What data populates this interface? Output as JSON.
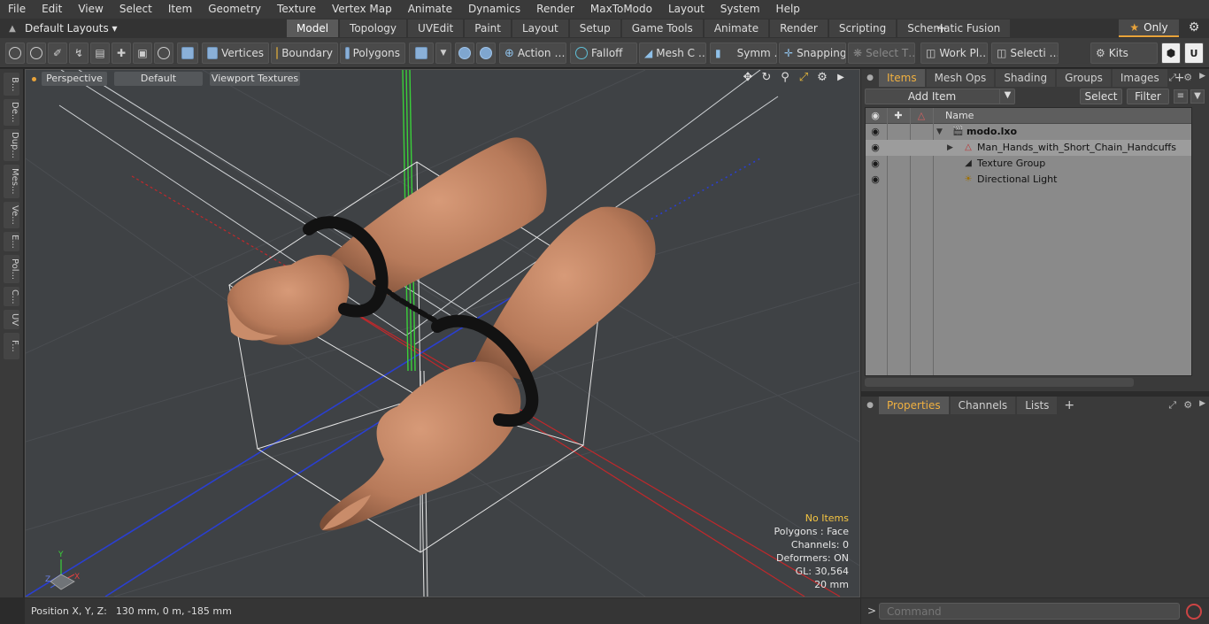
{
  "menu": [
    "File",
    "Edit",
    "View",
    "Select",
    "Item",
    "Geometry",
    "Texture",
    "Vertex Map",
    "Animate",
    "Dynamics",
    "Render",
    "MaxToModo",
    "Layout",
    "System",
    "Help"
  ],
  "layouts": {
    "label": "Default Layouts ▾"
  },
  "tabs": [
    "Model",
    "Topology",
    "UVEdit",
    "Paint",
    "Layout",
    "Setup",
    "Game Tools",
    "Animate",
    "Render",
    "Scripting",
    "Schematic Fusion"
  ],
  "only_label": "Only",
  "toolbar": {
    "vertices": "Vertices",
    "boundary": "Boundary",
    "polygons": "Polygons",
    "action": "Action",
    "falloff": "Falloff",
    "mesh": "Mesh C …",
    "symm": "Symm …",
    "snapping": "Snapping",
    "select_t": "Select T…",
    "workpl": "Work Pl…",
    "selecti": "Selecti …",
    "kits": "Kits"
  },
  "left_strip": [
    "B...",
    "De...",
    "Dup...",
    "Mes...",
    "Ve...",
    "E...",
    "Pol...",
    "C...",
    "UV",
    "F..."
  ],
  "viewport": {
    "view": "Perspective",
    "shading": "Default",
    "textures": "Viewport Textures",
    "stats": [
      "No Items",
      "Polygons : Face",
      "Channels: 0",
      "Deformers: ON",
      "GL: 30,564",
      "20 mm"
    ]
  },
  "status": {
    "label": "Position X, Y, Z:",
    "value": "130 mm, 0 m, -185 mm"
  },
  "items_panel": {
    "tabs": [
      "Items",
      "Mesh Ops",
      "Shading",
      "Groups",
      "Images"
    ],
    "add_item": "Add Item",
    "select": "Select",
    "filter": "Filter",
    "column": "Name",
    "rows": [
      "modo.lxo",
      "Man_Hands_with_Short_Chain_Handcuffs",
      "Texture Group",
      "Directional Light"
    ]
  },
  "props_panel": {
    "tabs": [
      "Properties",
      "Channels",
      "Lists"
    ]
  },
  "command": {
    "placeholder": "Command"
  },
  "colors": {
    "accent": "#e8a33a",
    "selected_tab": "#5a5a5a",
    "tree_bg": "#8a8a8a"
  }
}
